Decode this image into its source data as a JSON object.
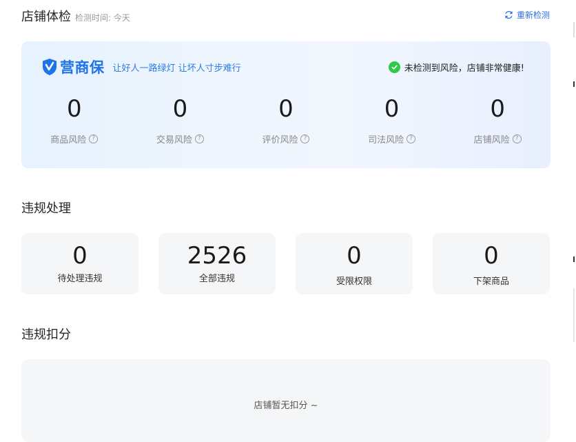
{
  "header": {
    "title": "店铺体检",
    "check_time": "检测时间: 今天",
    "recheck_label": "重新检测"
  },
  "health": {
    "brand_name": "营商保",
    "slogan": "让好人一路绿灯 让坏人寸步难行",
    "status_text": "未检测到风险，店铺非常健康!",
    "risks": [
      {
        "value": "0",
        "label": "商品风险"
      },
      {
        "value": "0",
        "label": "交易风险"
      },
      {
        "value": "0",
        "label": "评价风险"
      },
      {
        "value": "0",
        "label": "司法风险"
      },
      {
        "value": "0",
        "label": "店铺风险"
      }
    ]
  },
  "violations": {
    "title": "违规处理",
    "cards": [
      {
        "value": "0",
        "label": "待处理违规"
      },
      {
        "value": "2526",
        "label": "全部违规"
      },
      {
        "value": "0",
        "label": "受限权限"
      },
      {
        "value": "0",
        "label": "下架商品"
      }
    ]
  },
  "deductions": {
    "title": "违规扣分",
    "empty_text": "店铺暂无扣分 ~"
  },
  "colors": {
    "accent": "#2f6fe0",
    "brand": "#1f73e8",
    "success": "#32c84a",
    "card_bg": "#f5f6f8"
  }
}
